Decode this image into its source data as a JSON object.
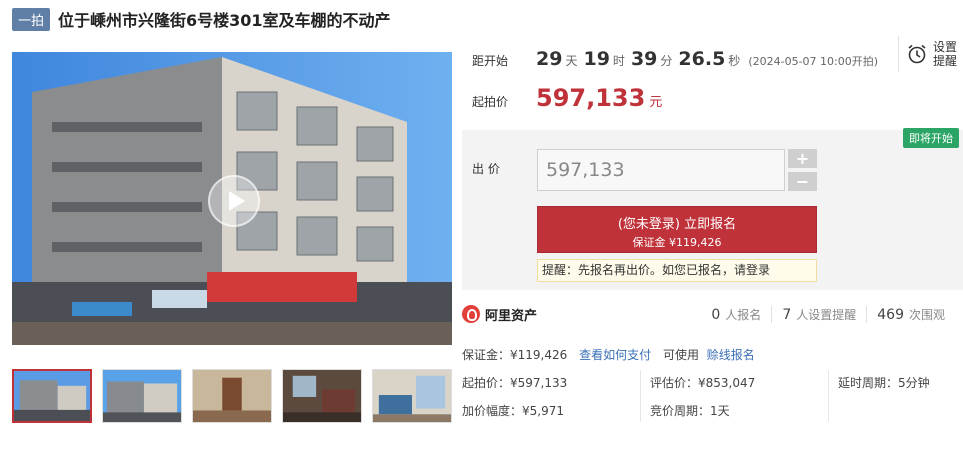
{
  "header": {
    "tag": "一拍",
    "title": "位于嵊州市兴隆街6号楼301室及车棚的不动产"
  },
  "countdown": {
    "label": "距开始",
    "days": "29",
    "days_unit": "天",
    "hours": "19",
    "hours_unit": "时",
    "minutes": "39",
    "minutes_unit": "分",
    "seconds": "26.5",
    "seconds_unit": "秒",
    "start_note": "(2024-05-07 10:00开拍)"
  },
  "reminder": {
    "label": "设置提醒",
    "icon": "alarm-clock-icon"
  },
  "start_price": {
    "label": "起拍价",
    "value": "597,133",
    "unit": "元"
  },
  "bid": {
    "status_badge": "即将开始",
    "label": "出    价",
    "input_value": "597,133",
    "plus": "+",
    "minus": "−",
    "signup_main": "(您未登录) 立即报名",
    "signup_sub": "保证金 ¥119,426",
    "tip_prefix": "提醒：先报名再出价。如您已报名，请",
    "tip_link": "登录"
  },
  "platform": {
    "name": "阿里资产",
    "stats": [
      {
        "num": "0",
        "unit": "人报名"
      },
      {
        "num": "7",
        "unit": "人设置提醒"
      },
      {
        "num": "469",
        "unit": "次围观"
      }
    ]
  },
  "deposit": {
    "text": "保证金：¥119,426",
    "link1": "查看如何支付",
    "plain": "可使用",
    "link2": "赊线报名"
  },
  "info": {
    "start_price": "起拍价：¥597,133",
    "appraisal": "评估价：¥853,047",
    "delay": "延时周期：5分钟",
    "increment": "加价幅度：¥5,971",
    "bid_cycle": "竞价周期：1天"
  },
  "colors": {
    "accent_red": "#c0323a",
    "tag_blue": "#5f7fa7",
    "badge_green": "#2aa565",
    "link_blue": "#3a6fb6"
  }
}
